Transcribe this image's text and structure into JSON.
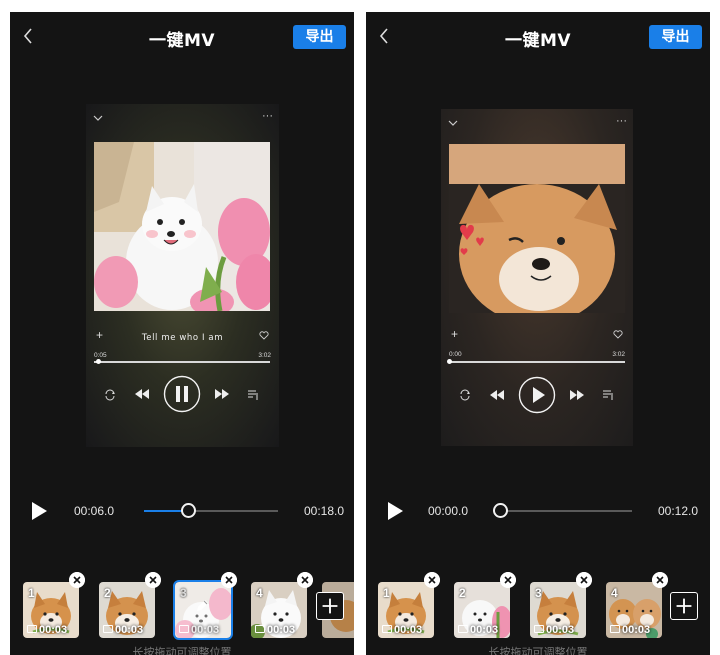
{
  "screens": [
    {
      "app_title": "一键MV",
      "export_label": "导出",
      "song_title": "Tell me who I am",
      "song_elapsed": "0:05",
      "song_total": "3:02",
      "song_progress": 0.027,
      "player_state": "playing",
      "timeline_current": "00:06.0",
      "timeline_total": "00:18.0",
      "timeline_progress": 0.333,
      "clips": [
        {
          "number": "1",
          "duration": "00:03",
          "subject": "shiba-dog"
        },
        {
          "number": "2",
          "duration": "00:03",
          "subject": "shiba-dog"
        },
        {
          "number": "3",
          "duration": "00:03",
          "subject": "white-dog",
          "selected": true
        },
        {
          "number": "4",
          "duration": "00:03",
          "subject": "white-dog"
        }
      ],
      "hint": "长按拖动可调整位置"
    },
    {
      "app_title": "一键MV",
      "export_label": "导出",
      "song_elapsed": "0:00",
      "song_total": "3:02",
      "song_progress": 0.0,
      "player_state": "paused",
      "timeline_current": "00:00.0",
      "timeline_total": "00:12.0",
      "timeline_progress": 0.0,
      "clips": [
        {
          "number": "1",
          "duration": "00:03",
          "subject": "shiba-dog"
        },
        {
          "number": "2",
          "duration": "00:03",
          "subject": "white-dog"
        },
        {
          "number": "3",
          "duration": "00:03",
          "subject": "shiba-dog"
        },
        {
          "number": "4",
          "duration": "00:03",
          "subject": "two-dogs"
        }
      ],
      "hint": "长按拖动可调整位置"
    }
  ],
  "colors": {
    "accent": "#1a7fe8",
    "background": "#141414"
  }
}
